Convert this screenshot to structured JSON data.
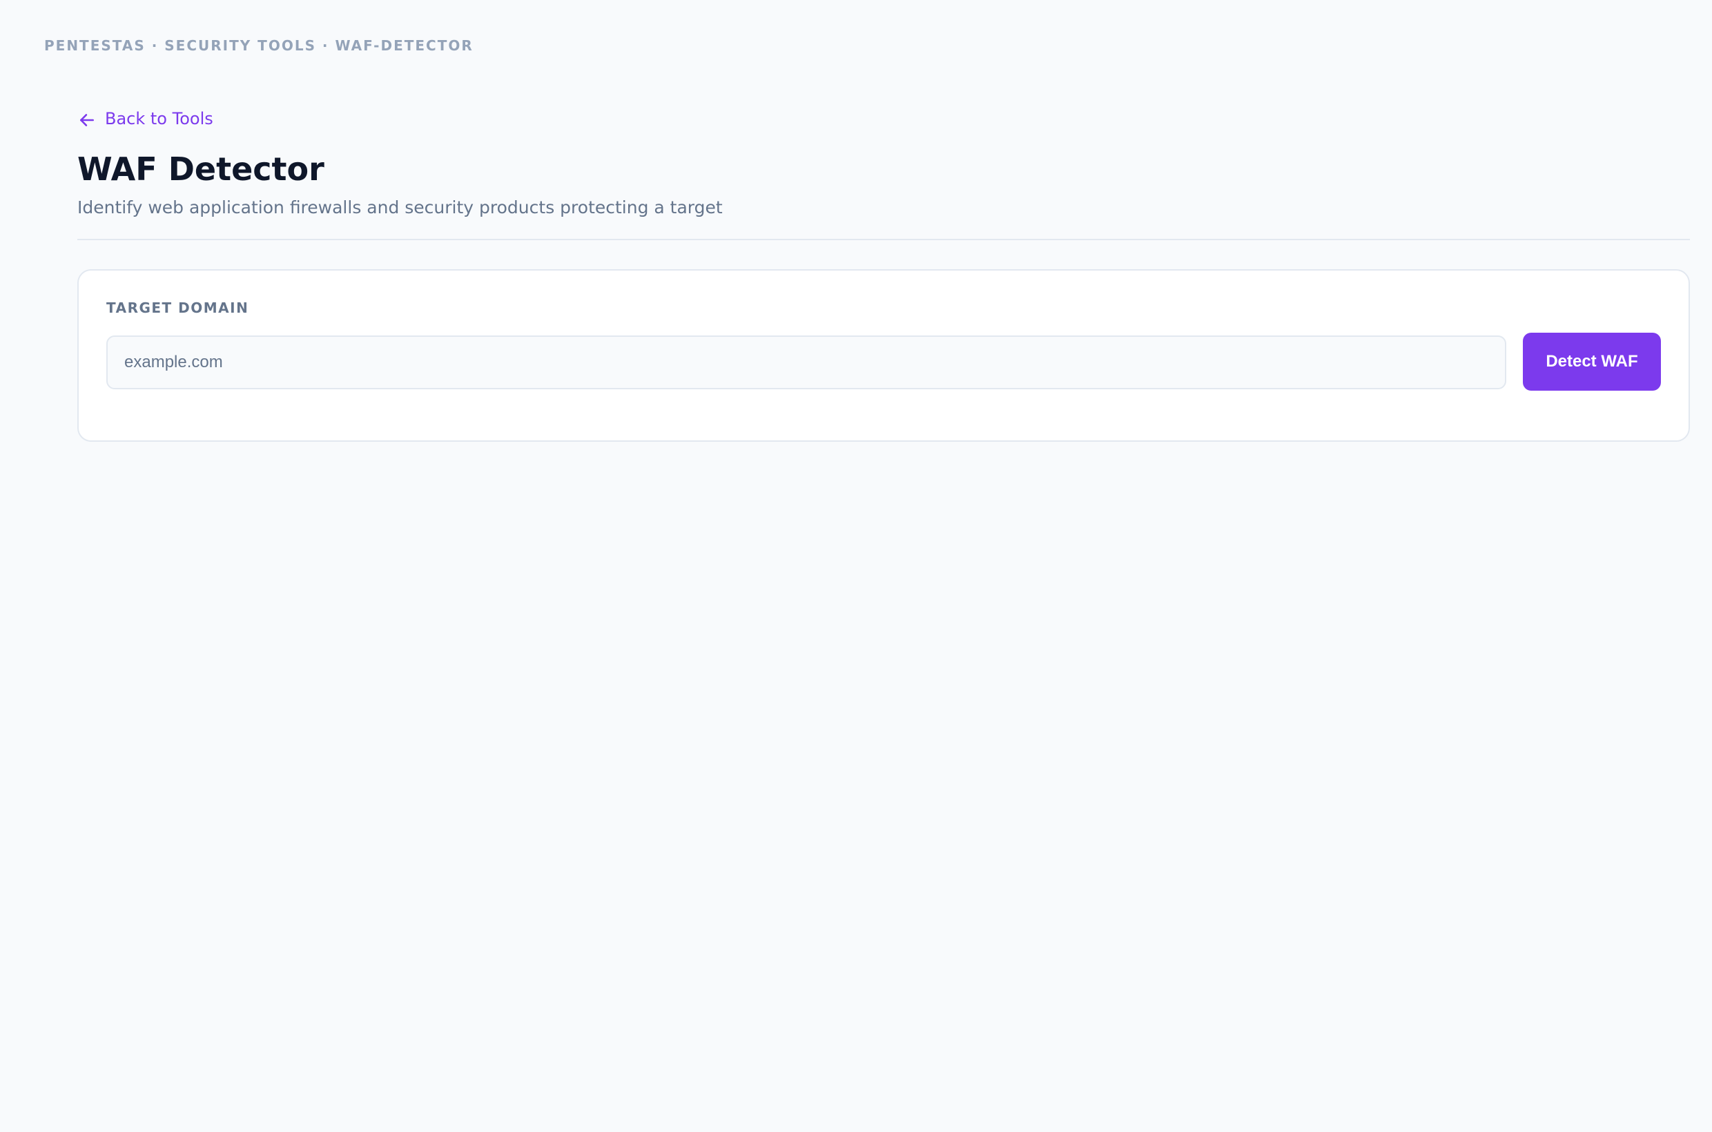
{
  "breadcrumb": {
    "text": "PENTESTAS · SECURITY TOOLS · WAF-DETECTOR"
  },
  "nav": {
    "back_label": "Back to Tools",
    "back_icon": "arrow-left-icon"
  },
  "header": {
    "title": "WAF Detector",
    "subtitle": "Identify web application firewalls and security products protecting a target"
  },
  "form": {
    "label": "TARGET DOMAIN",
    "input_value": "",
    "placeholder": "example.com",
    "submit_label": "Detect WAF"
  },
  "colors": {
    "accent": "#7c3aed",
    "background": "#f8fafc",
    "title": "#0f172a",
    "muted": "#64748b",
    "border": "#e2e8f0"
  }
}
